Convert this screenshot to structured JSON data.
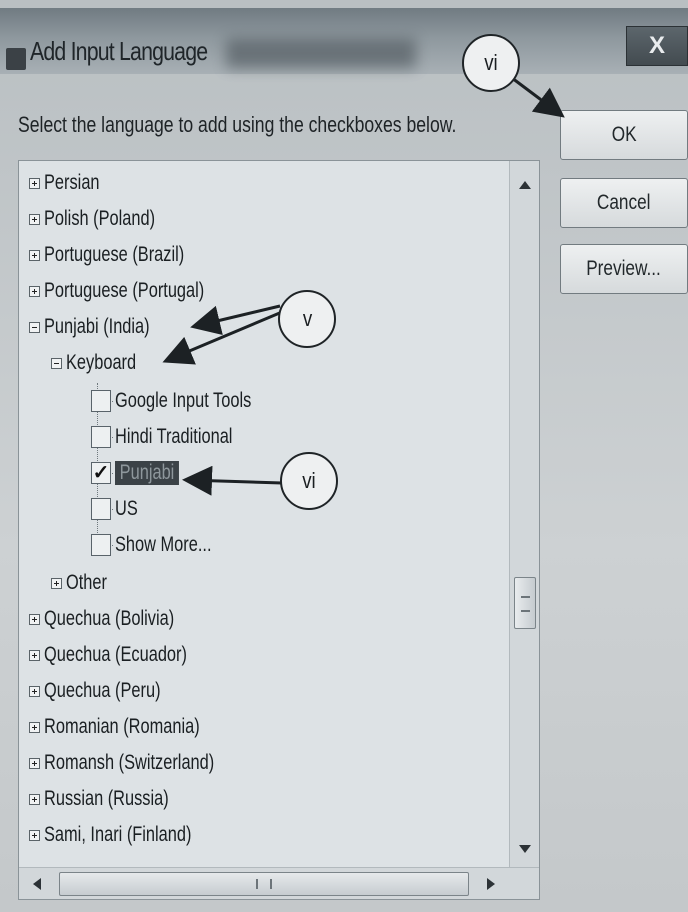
{
  "dialog": {
    "title": "Add Input Language",
    "close_label": "X",
    "instruction": "Select the language to add using the checkboxes below."
  },
  "buttons": {
    "ok": "OK",
    "cancel": "Cancel",
    "preview": "Preview..."
  },
  "languages": {
    "persian": "Persian",
    "polish": "Polish (Poland)",
    "pt_brazil": "Portuguese (Brazil)",
    "pt_portugal": "Portuguese (Portugal)",
    "punjabi": "Punjabi (India)",
    "keyboard": "Keyboard",
    "kb_google": "Google Input Tools",
    "kb_hindi": "Hindi Traditional",
    "kb_punjabi": "Punjabi",
    "kb_us": "US",
    "kb_more": "Show More...",
    "other": "Other",
    "quechua_bolivia": "Quechua (Bolivia)",
    "quechua_ecuador": "Quechua (Ecuador)",
    "quechua_peru": "Quechua (Peru)",
    "romanian": "Romanian (Romania)",
    "romansh": "Romansh (Switzerland)",
    "russian": "Russian (Russia)",
    "sami": "Sami, Inari (Finland)"
  },
  "checkbox_states": {
    "kb_google": false,
    "kb_hindi": false,
    "kb_punjabi": true,
    "kb_us": false,
    "kb_more": false
  },
  "check_glyph": "✓",
  "annotations": {
    "callout_ok": "vi",
    "callout_tree": "v",
    "callout_punjabi": "vi"
  }
}
